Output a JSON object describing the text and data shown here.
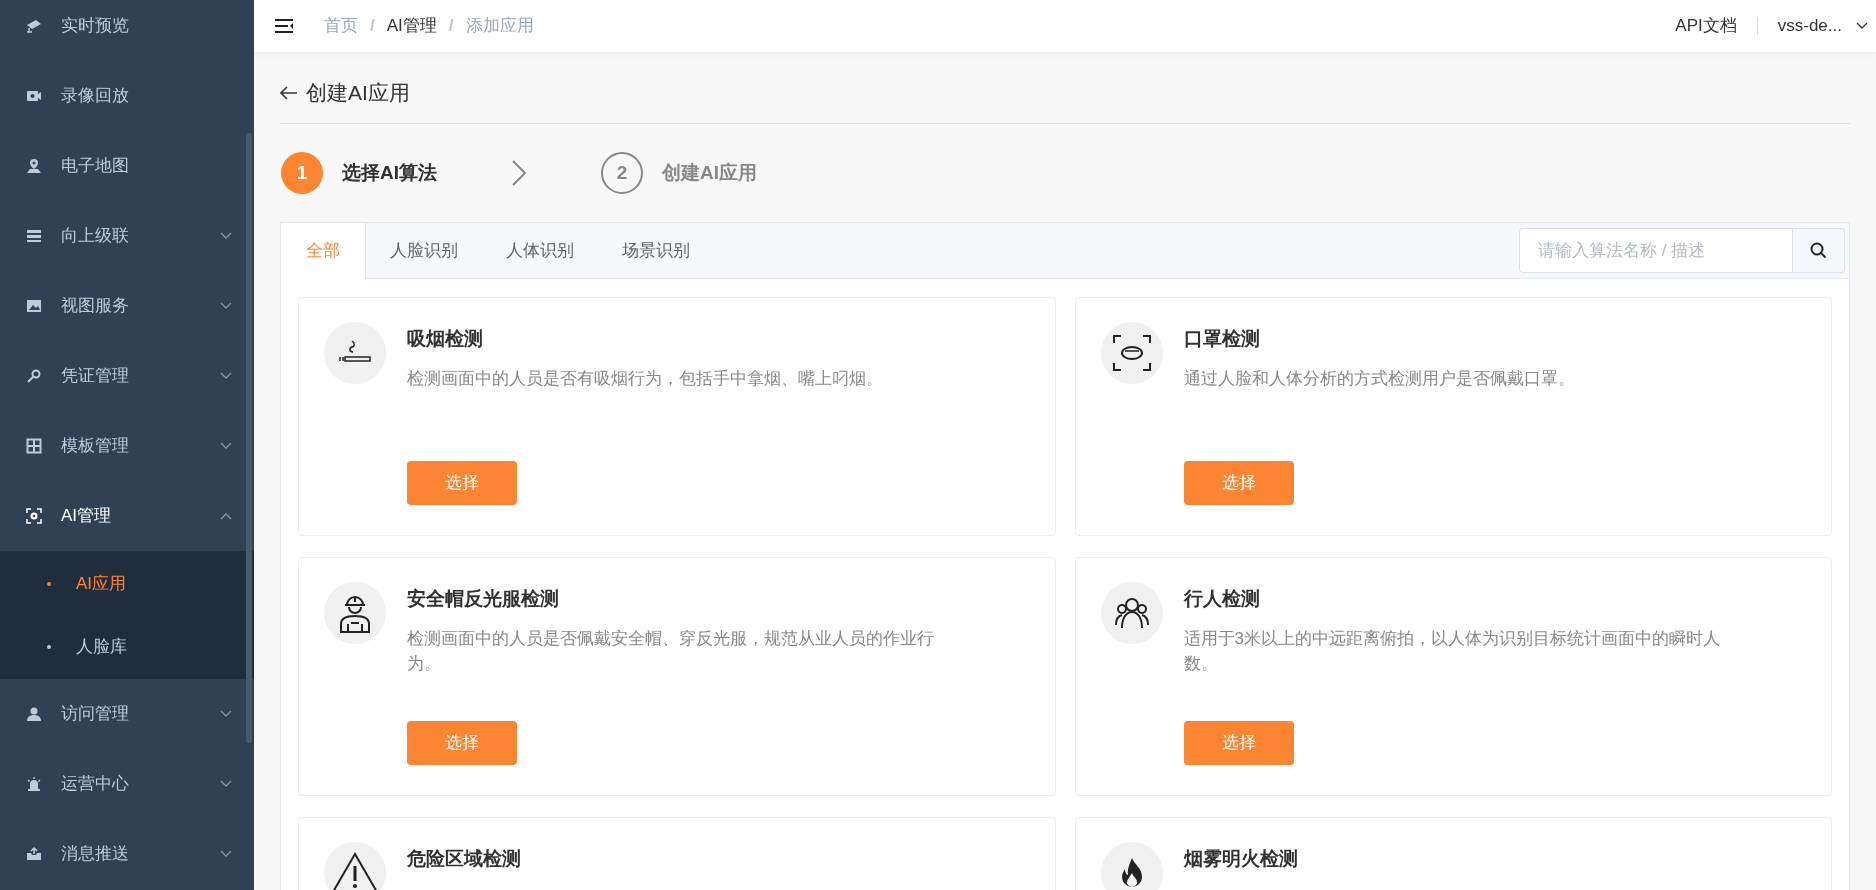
{
  "sidebar": {
    "items": [
      {
        "kind": "link",
        "label": "实时预览"
      },
      {
        "kind": "link",
        "label": "录像回放"
      },
      {
        "kind": "link",
        "label": "电子地图"
      },
      {
        "kind": "group",
        "label": "向上级联",
        "expanded": false
      },
      {
        "kind": "group",
        "label": "视图服务",
        "expanded": false
      },
      {
        "kind": "group",
        "label": "凭证管理",
        "expanded": false
      },
      {
        "kind": "group",
        "label": "模板管理",
        "expanded": false
      },
      {
        "kind": "group",
        "label": "AI管理",
        "expanded": true,
        "children": [
          {
            "label": "AI应用",
            "selected": true
          },
          {
            "label": "人脸库",
            "selected": false
          }
        ]
      },
      {
        "kind": "group",
        "label": "访问管理",
        "expanded": false
      },
      {
        "kind": "group",
        "label": "运营中心",
        "expanded": false
      },
      {
        "kind": "group",
        "label": "消息推送",
        "expanded": false
      }
    ]
  },
  "header": {
    "breadcrumb": [
      {
        "label": "首页",
        "hovered": false
      },
      {
        "label": "AI管理",
        "hovered": true
      },
      {
        "label": "添加应用",
        "hovered": false
      }
    ],
    "separator": "/",
    "api_link": "API文档",
    "user": "vss-de..."
  },
  "page": {
    "back_title": "创建AI应用",
    "steps": [
      {
        "number": "1",
        "label": "选择AI算法",
        "selected": true
      },
      {
        "number": "2",
        "label": "创建AI应用",
        "selected": false
      }
    ],
    "tabs": [
      {
        "label": "全部",
        "selected": true
      },
      {
        "label": "人脸识别",
        "selected": false
      },
      {
        "label": "人体识别",
        "selected": false
      },
      {
        "label": "场景识别",
        "selected": false
      }
    ],
    "search": {
      "placeholder": "请输入算法名称 / 描述"
    },
    "cards": [
      {
        "title": "吸烟检测",
        "description": "检测画面中的人员是否有吸烟行为，包括手中拿烟、嘴上叼烟。",
        "button": "选择"
      },
      {
        "title": "口罩检测",
        "description": "通过人脸和人体分析的方式检测用户是否佩戴口罩。",
        "button": "选择"
      },
      {
        "title": "安全帽反光服检测",
        "description": "检测画面中的人员是否佩戴安全帽、穿反光服，规范从业人员的作业行为。",
        "button": "选择"
      },
      {
        "title": "行人检测",
        "description": "适用于3米以上的中远距离俯拍，以人体为识别目标统计画面中的瞬时人数。",
        "button": "选择"
      },
      {
        "title": "危险区域检测"
      },
      {
        "title": "烟雾明火检测"
      }
    ]
  }
}
